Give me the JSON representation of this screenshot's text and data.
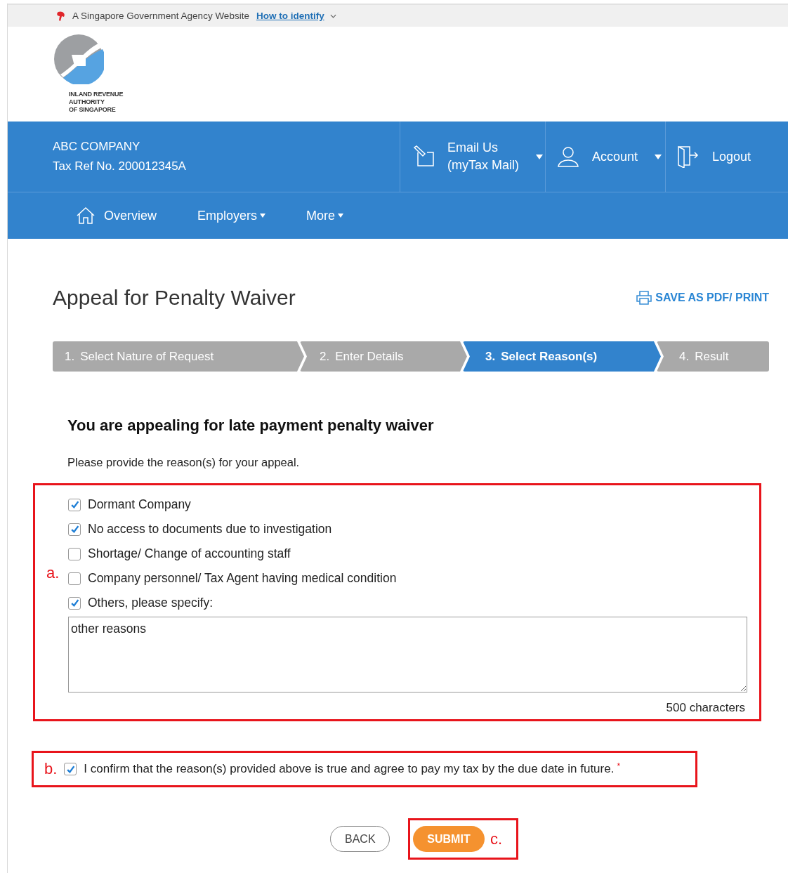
{
  "gov_bar": {
    "text": "A Singapore Government Agency Website",
    "link": "How to identify"
  },
  "logo": {
    "lines": [
      "INLAND REVENUE",
      "AUTHORITY",
      "OF SINGAPORE"
    ]
  },
  "header": {
    "company": "ABC COMPANY",
    "tax_ref": "Tax Ref No. 200012345A",
    "actions": [
      {
        "kind": "mail",
        "lines": [
          "Email Us",
          "(myTax Mail)"
        ],
        "dropdown": true
      },
      {
        "kind": "account",
        "lines": [
          "Account"
        ],
        "dropdown": true
      },
      {
        "kind": "logout",
        "lines": [
          "Logout"
        ],
        "dropdown": false
      }
    ]
  },
  "nav": [
    {
      "kind": "home",
      "label": "Overview",
      "dropdown": false
    },
    {
      "kind": "menu",
      "label": "Employers",
      "dropdown": true
    },
    {
      "kind": "menu",
      "label": "More",
      "dropdown": true
    }
  ],
  "page_title": "Appeal for Penalty Waiver",
  "print_link": "SAVE AS PDF/ PRINT",
  "steps": [
    {
      "number": "1.",
      "label": "Select Nature of Request",
      "selected": false
    },
    {
      "number": "2.",
      "label": "Enter Details",
      "selected": false
    },
    {
      "number": "3.",
      "label": "Select Reason(s)",
      "selected": true
    },
    {
      "number": "4.",
      "label": "Result",
      "selected": false
    }
  ],
  "heading": "You are appealing for late payment penalty waiver",
  "instruction": "Please provide the reason(s) for your appeal.",
  "reasons": [
    {
      "label": "Dormant Company",
      "checked": true
    },
    {
      "label": "No access to documents due to investigation",
      "checked": true
    },
    {
      "label": "Shortage/ Change of accounting staff",
      "checked": false
    },
    {
      "label": "Company personnel/ Tax Agent having medical condition",
      "checked": false
    },
    {
      "label": "Others, please specify:",
      "checked": true
    }
  ],
  "other_reason": {
    "value": "other reasons"
  },
  "char_count": "500 characters",
  "confirm": {
    "label": "I confirm that the reason(s) provided above is true and agree to pay my tax by the due date in future.",
    "checked": true,
    "required_mark": "*"
  },
  "buttons": [
    {
      "kind": "secondary",
      "label": "BACK"
    },
    {
      "kind": "primary",
      "label": "SUBMIT"
    }
  ],
  "annotations": [
    {
      "label": "a."
    },
    {
      "label": "b."
    },
    {
      "label": "c."
    }
  ]
}
